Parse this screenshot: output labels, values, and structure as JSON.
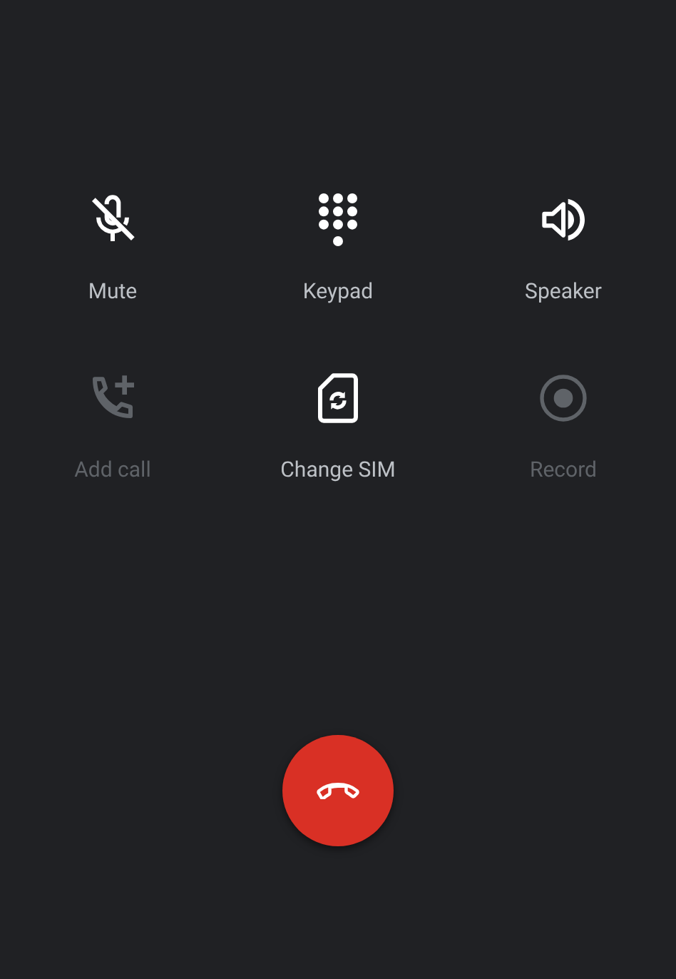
{
  "controls": [
    {
      "kind": "mute",
      "label": "Mute",
      "disabled": false
    },
    {
      "kind": "keypad",
      "label": "Keypad",
      "disabled": false
    },
    {
      "kind": "speaker",
      "label": "Speaker",
      "disabled": false
    },
    {
      "kind": "add_call",
      "label": "Add call",
      "disabled": true
    },
    {
      "kind": "change_sim",
      "label": "Change SIM",
      "disabled": false
    },
    {
      "kind": "record",
      "label": "Record",
      "disabled": true
    }
  ]
}
